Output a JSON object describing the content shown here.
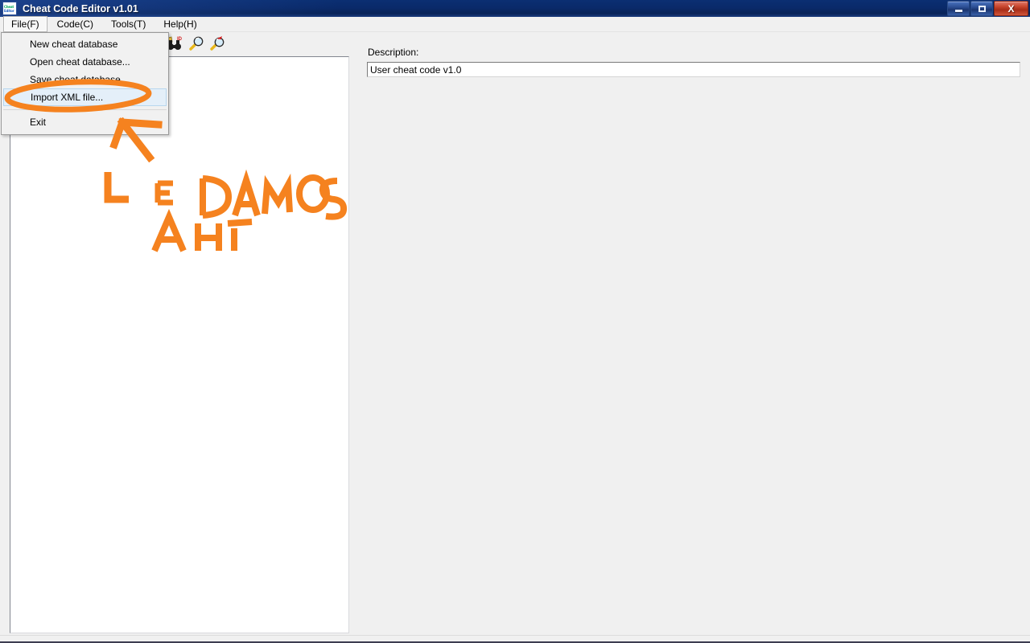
{
  "window": {
    "title": "Cheat Code Editor v1.01",
    "icon": "app-icon",
    "icon_line1": "Cheat",
    "icon_line2": "Editor",
    "controls": {
      "minimize": "minimize-button",
      "maximize": "restore-button",
      "close_label": "X"
    },
    "titlebar_color": "#0a2a6a",
    "close_color": "#c94830"
  },
  "menubar": {
    "items": [
      {
        "label": "File(F)",
        "active": true
      },
      {
        "label": "Code(C)",
        "active": false
      },
      {
        "label": "Tools(T)",
        "active": false
      },
      {
        "label": "Help(H)",
        "active": false
      }
    ]
  },
  "toolbar": {
    "buttons": [
      {
        "name": "find-id-binoculars-icon",
        "tip": "Find by ID"
      },
      {
        "name": "search-icon",
        "tip": "Search"
      },
      {
        "name": "search-next-icon",
        "tip": "Search next"
      }
    ]
  },
  "file_menu": {
    "items": [
      {
        "label": "New cheat database",
        "highlighted": false,
        "separator_after": false
      },
      {
        "label": "Open cheat database...",
        "highlighted": false,
        "separator_after": false
      },
      {
        "label": "Save cheat database...",
        "highlighted": false,
        "separator_after": false
      },
      {
        "label": "Import XML file...",
        "highlighted": true,
        "separator_after": true
      },
      {
        "label": "Exit",
        "highlighted": false,
        "separator_after": false
      }
    ],
    "highlight_color": "#e4eff9"
  },
  "left_panel": {
    "name": "cheat-code-tree",
    "items": []
  },
  "details": {
    "description_label": "Description:",
    "description_value": "User cheat code v1.0",
    "description_placeholder": ""
  },
  "statusbar": {
    "text": ""
  },
  "annotation": {
    "color": "#f5821f",
    "text_lines": [
      "LE",
      "DAMOS",
      "AHI"
    ],
    "full_text": "LE DAMOS AHI",
    "shapes": [
      "ellipse-around-import-xml-file",
      "arrow-pointing-up-left"
    ]
  }
}
